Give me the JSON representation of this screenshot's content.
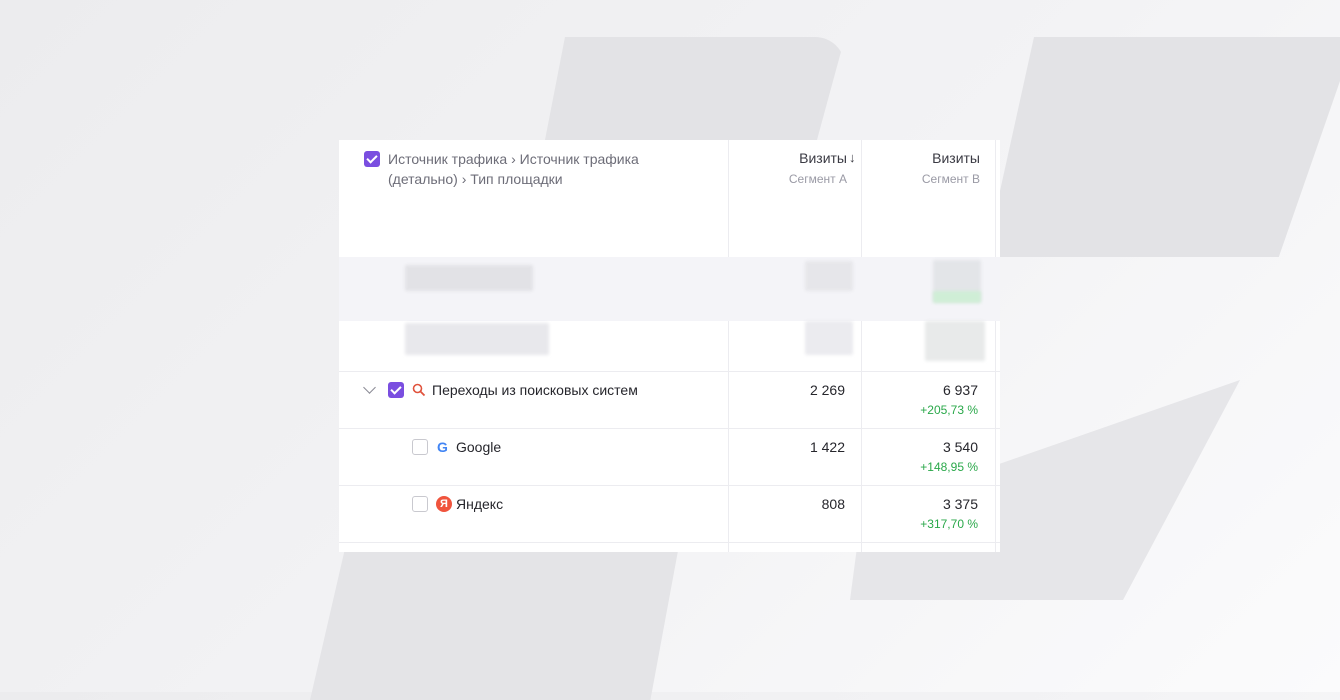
{
  "header": {
    "dimension_title": "Источник трафика › Источник трафика (детально) › Тип площадки",
    "columns": [
      {
        "title": "Визиты",
        "subtitle": "Сегмент А"
      },
      {
        "title": "Визиты",
        "subtitle": "Сегмент В"
      }
    ]
  },
  "rows": [
    {
      "label": "Переходы из поисковых систем",
      "icon": "search-icon",
      "checked": true,
      "expanded": true,
      "a": "2 269",
      "b": "6 937",
      "delta": "+205,73 %"
    },
    {
      "label": "Google",
      "icon": "google-icon",
      "checked": false,
      "a": "1 422",
      "b": "3 540",
      "delta": "+148,95 %"
    },
    {
      "label": "Яндекс",
      "icon": "yandex-icon",
      "checked": false,
      "a": "808",
      "b": "3 375",
      "delta": "+317,70 %"
    }
  ],
  "colors": {
    "accent": "#7a4ee0",
    "positive": "#2aa84a"
  },
  "icons": {
    "yandex_letter": "Я",
    "google_letter": "G"
  }
}
